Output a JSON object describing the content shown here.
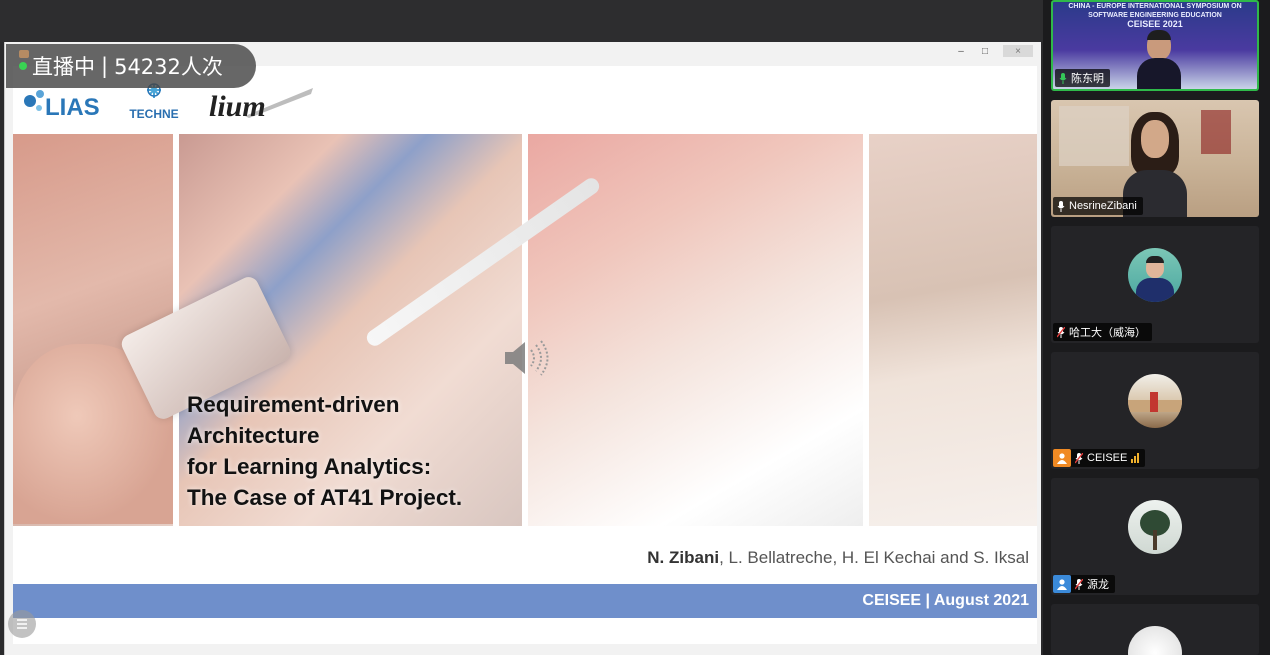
{
  "live": {
    "status_label": "直播中",
    "separator": "|",
    "viewer_count": "54232人次"
  },
  "slide": {
    "logos": {
      "lias": "LIAS",
      "techne": "TECHNE",
      "lium": "lium"
    },
    "title_lines": [
      "Requirement-driven",
      "Architecture",
      "for Learning Analytics:",
      "The Case of AT41 Project."
    ],
    "authors": {
      "first": "N. Zibani",
      "rest": ", L. Bellatreche, H. El Kechai and S. Iksal"
    },
    "footer": "CEISEE | August 2021"
  },
  "window": {
    "minimize": "–",
    "maximize": "□",
    "close": "×"
  },
  "participants": [
    {
      "name": "陈东明",
      "banner": [
        "CHINA - EUROPE INTERNATIONAL SYMPOSIUM ON",
        "SOFTWARE ENGINEERING EDUCATION",
        "CEISEE 2021"
      ],
      "mic": "on",
      "active": true
    },
    {
      "name": "NesrineZibani",
      "mic": "on",
      "active": false
    },
    {
      "name": "哈工大（威海）",
      "mic": "muted",
      "active": false
    },
    {
      "name": "CEISEE",
      "mic": "muted",
      "badge": "orange",
      "signal": true,
      "active": false
    },
    {
      "name": "源龙",
      "mic": "muted",
      "badge": "blue",
      "active": false
    }
  ],
  "colors": {
    "footer_bar": "#6f8fcb",
    "active_border": "#2fb94a",
    "live_dot": "#39d353"
  },
  "icons": [
    "speaker-icon",
    "list-icon",
    "mic-icon",
    "mic-muted-icon",
    "user-icon",
    "signal-icon"
  ]
}
